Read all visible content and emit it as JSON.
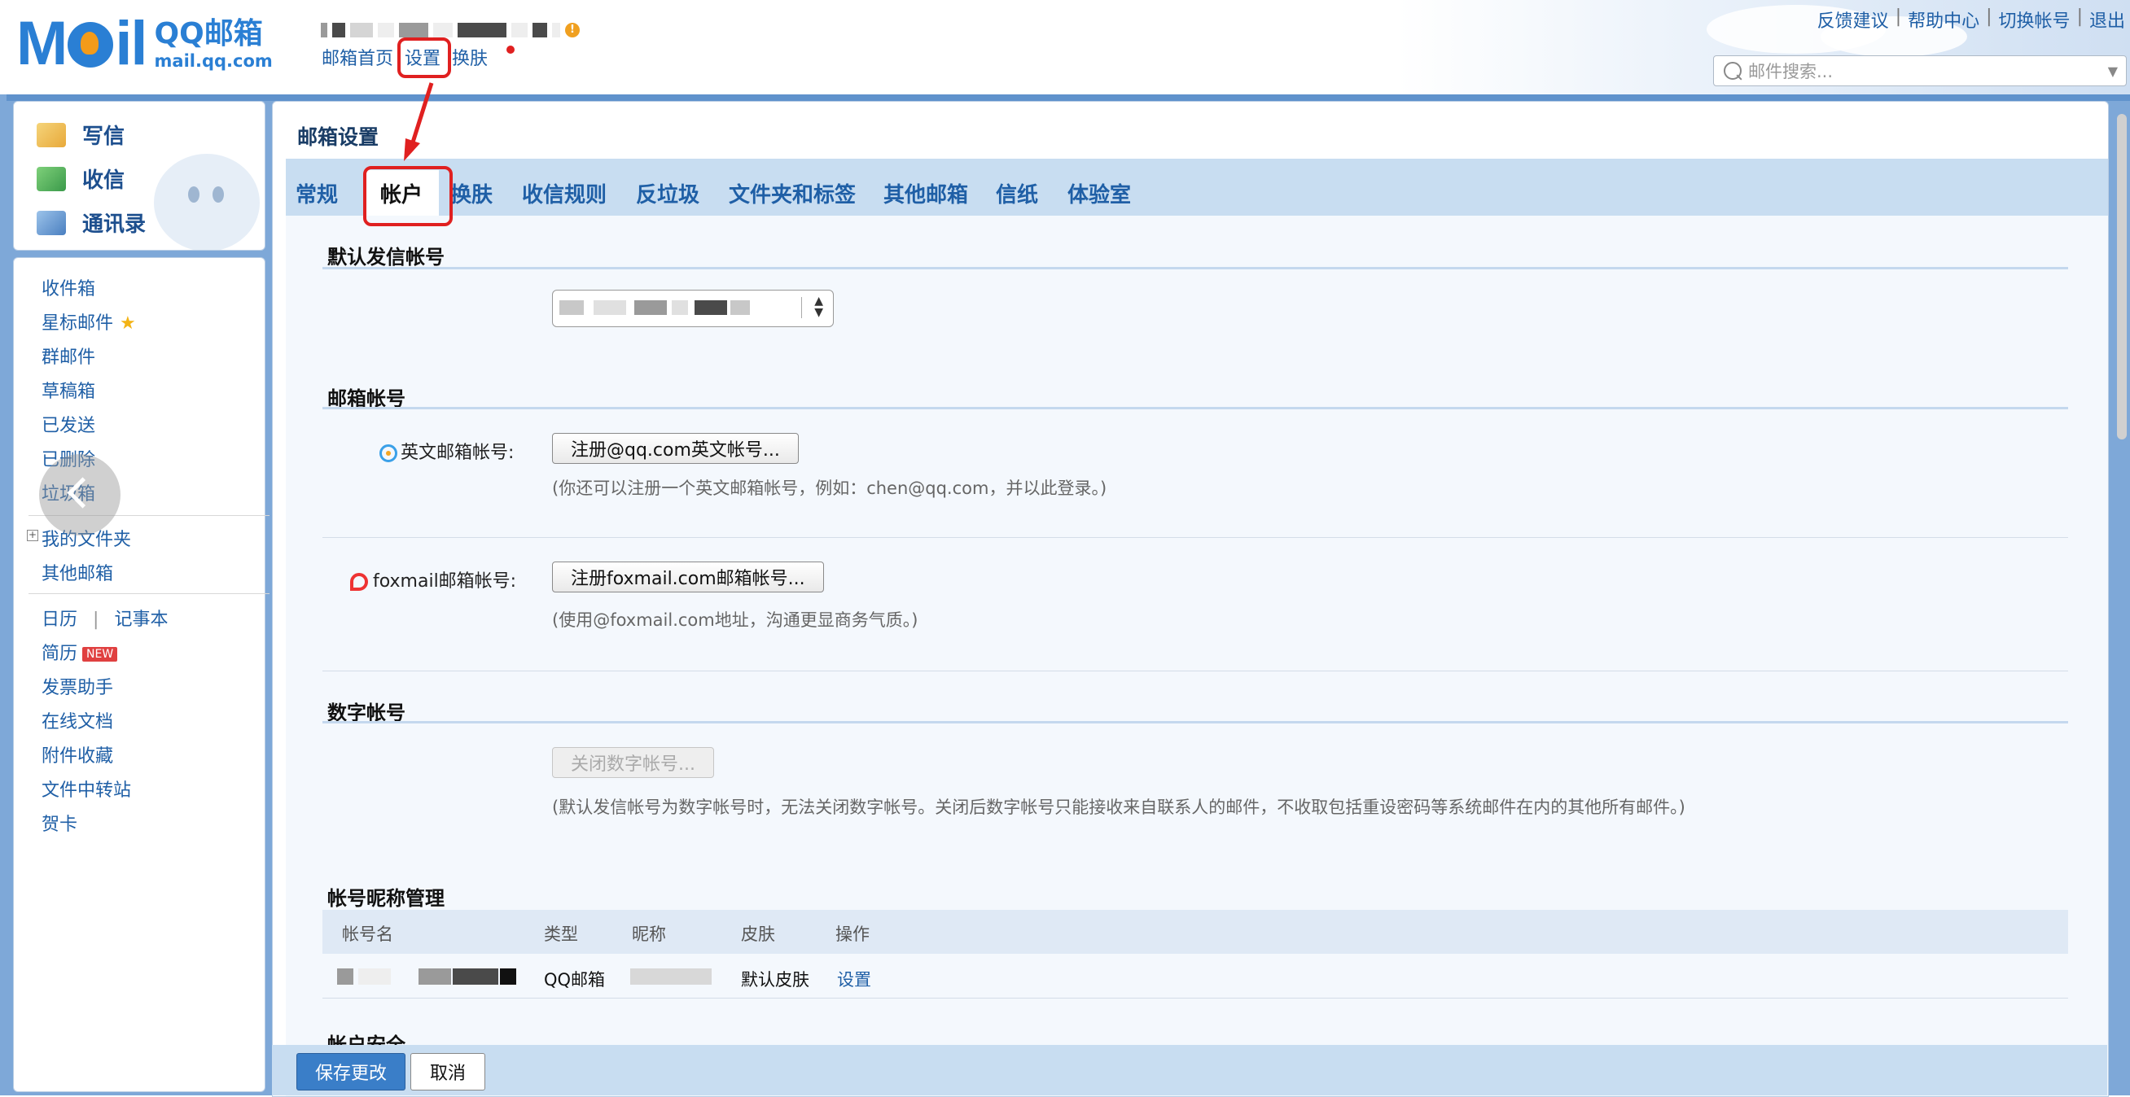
{
  "header": {
    "logo_text": "Mail",
    "brand_title": "QQ邮箱",
    "brand_domain": "mail.qq.com",
    "nav_home": "邮箱首页",
    "nav_settings": "设置",
    "nav_skin": "换肤",
    "feedback": "反馈建议",
    "help": "帮助中心",
    "switch_account": "切换帐号",
    "logout": "退出",
    "separator": "|",
    "search_placeholder": "邮件搜索..."
  },
  "quick_actions": {
    "compose": "写信",
    "receive": "收信",
    "contacts": "通讯录"
  },
  "folders": {
    "inbox": "收件箱",
    "starred": "星标邮件",
    "group_mail": "群邮件",
    "drafts": "草稿箱",
    "sent": "已发送",
    "deleted": "已删除",
    "spam": "垃圾箱",
    "my_folders": "我的文件夹",
    "other_mailbox": "其他邮箱",
    "calendar": "日历",
    "notebook": "记事本",
    "resume": "简历",
    "new_badge": "NEW",
    "invoice": "发票助手",
    "online_docs": "在线文档",
    "attachments": "附件收藏",
    "file_transfer": "文件中转站",
    "greeting_card": "贺卡"
  },
  "settings": {
    "title": "邮箱设置",
    "tabs": [
      "常规",
      "帐户",
      "换肤",
      "收信规则",
      "反垃圾",
      "文件夹和标签",
      "其他邮箱",
      "信纸",
      "体验室"
    ],
    "default_sender_title": "默认发信帐号",
    "mailbox_accounts_title": "邮箱帐号",
    "english_account_label": "英文邮箱帐号:",
    "english_account_button": "注册@qq.com英文帐号...",
    "english_account_hint": "(你还可以注册一个英文邮箱帐号，例如：chen@qq.com，并以此登录。)",
    "foxmail_account_label": "foxmail邮箱帐号:",
    "foxmail_account_button": "注册foxmail.com邮箱帐号...",
    "foxmail_account_hint": "(使用@foxmail.com地址，沟通更显商务气质。)",
    "digital_account_title": "数字帐号",
    "digital_account_button": "关闭数字帐号...",
    "digital_account_hint": "(默认发信帐号为数字帐号时，无法关闭数字帐号。关闭后数字帐号只能接收来自联系人的邮件，不收取包括重设密码等系统邮件在内的其他所有邮件。)",
    "nickname_title": "帐号昵称管理",
    "table_headers": [
      "帐号名",
      "类型",
      "昵称",
      "皮肤",
      "操作"
    ],
    "table_row": {
      "type": "QQ邮箱",
      "skin": "默认皮肤",
      "action": "设置"
    },
    "security_title_partial": "帐户安全"
  },
  "footer": {
    "save": "保存更改",
    "cancel": "取消"
  },
  "colors": {
    "accent": "#1f5fa6",
    "highlight": "#e02020",
    "tabbar": "#c8ddf1",
    "frame": "#7ea8d8"
  }
}
